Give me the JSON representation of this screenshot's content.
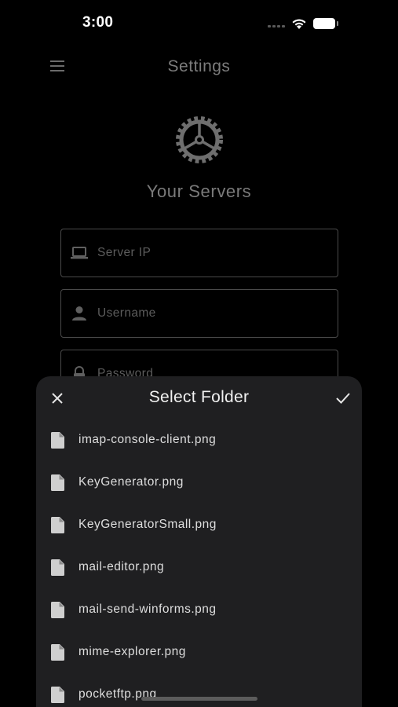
{
  "status_bar": {
    "time": "3:00"
  },
  "background": {
    "page_title": "Settings",
    "section_title": "Your Servers",
    "fields": [
      {
        "label": "Server IP",
        "icon": "laptop-icon"
      },
      {
        "label": "Username",
        "icon": "person-icon"
      },
      {
        "label": "Password",
        "icon": "lock-icon"
      }
    ]
  },
  "sheet": {
    "title": "Select Folder",
    "files": [
      "imap-console-client.png",
      "KeyGenerator.png",
      "KeyGeneratorSmall.png",
      "mail-editor.png",
      "mail-send-winforms.png",
      "mime-explorer.png",
      "pocketftp.png"
    ]
  },
  "colors": {
    "background": "#000000",
    "sheet": "#1f1f21",
    "primary_text": "#f0f0f0",
    "dimmed_text": "#7c7c7c"
  }
}
